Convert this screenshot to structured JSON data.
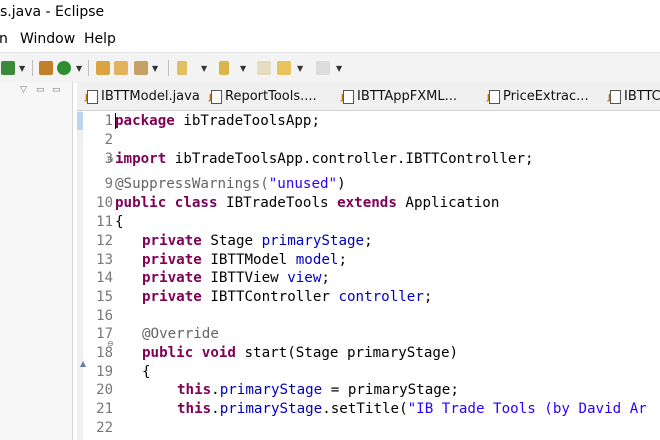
{
  "window": {
    "title": "s.java - Eclipse"
  },
  "menu": {
    "items": [
      "n",
      "Window",
      "Help"
    ]
  },
  "tabs": [
    {
      "label": "IBTTModel.java"
    },
    {
      "label": "ReportTools...."
    },
    {
      "label": "IBTTAppFXML..."
    },
    {
      "label": "PriceExtrac..."
    },
    {
      "label": "IBTTC"
    }
  ],
  "editor": {
    "line_numbers": [
      "1",
      "2",
      "3",
      "9",
      "10",
      "11",
      "12",
      "13",
      "14",
      "15",
      "16",
      "17",
      "18",
      "19",
      "20",
      "21",
      "22"
    ],
    "lines": [
      {
        "kw": "package",
        "rest": " ibTradeToolsApp;"
      },
      {
        "text": ""
      },
      {
        "kw": "import",
        "rest": " ibTradeToolsApp.controller.IBTTController;"
      },
      {
        "ann": "@SuppressWarnings(",
        "str": "\"unused\"",
        "rest": ")"
      },
      {
        "kw": "public class",
        "rest": " IBTradeTools ",
        "kw2": "extends",
        "rest2": " Application"
      },
      {
        "text": "{"
      },
      {
        "kw": "private",
        "rest": " Stage ",
        "fld": "primaryStage",
        "rest2": ";"
      },
      {
        "kw": "private",
        "rest": " IBTTModel ",
        "fld": "model",
        "rest2": ";"
      },
      {
        "kw": "private",
        "rest": " IBTTView ",
        "fld": "view",
        "rest2": ";"
      },
      {
        "kw": "private",
        "rest": " IBTTController ",
        "fld": "controller",
        "rest2": ";"
      },
      {
        "text": ""
      },
      {
        "ann": "@Override"
      },
      {
        "kw": "public void",
        "rest": " start(Stage primaryStage)"
      },
      {
        "text": "{"
      },
      {
        "kw": "this",
        "rest": ".",
        "fld": "primaryStage",
        "rest2": " = primaryStage;"
      },
      {
        "kw": "this",
        "rest": ".",
        "fld": "primaryStage",
        "rest2": ".setTitle(",
        "str": "\"IB Trade Tools (by David Ar"
      },
      {
        "text": ""
      }
    ]
  }
}
